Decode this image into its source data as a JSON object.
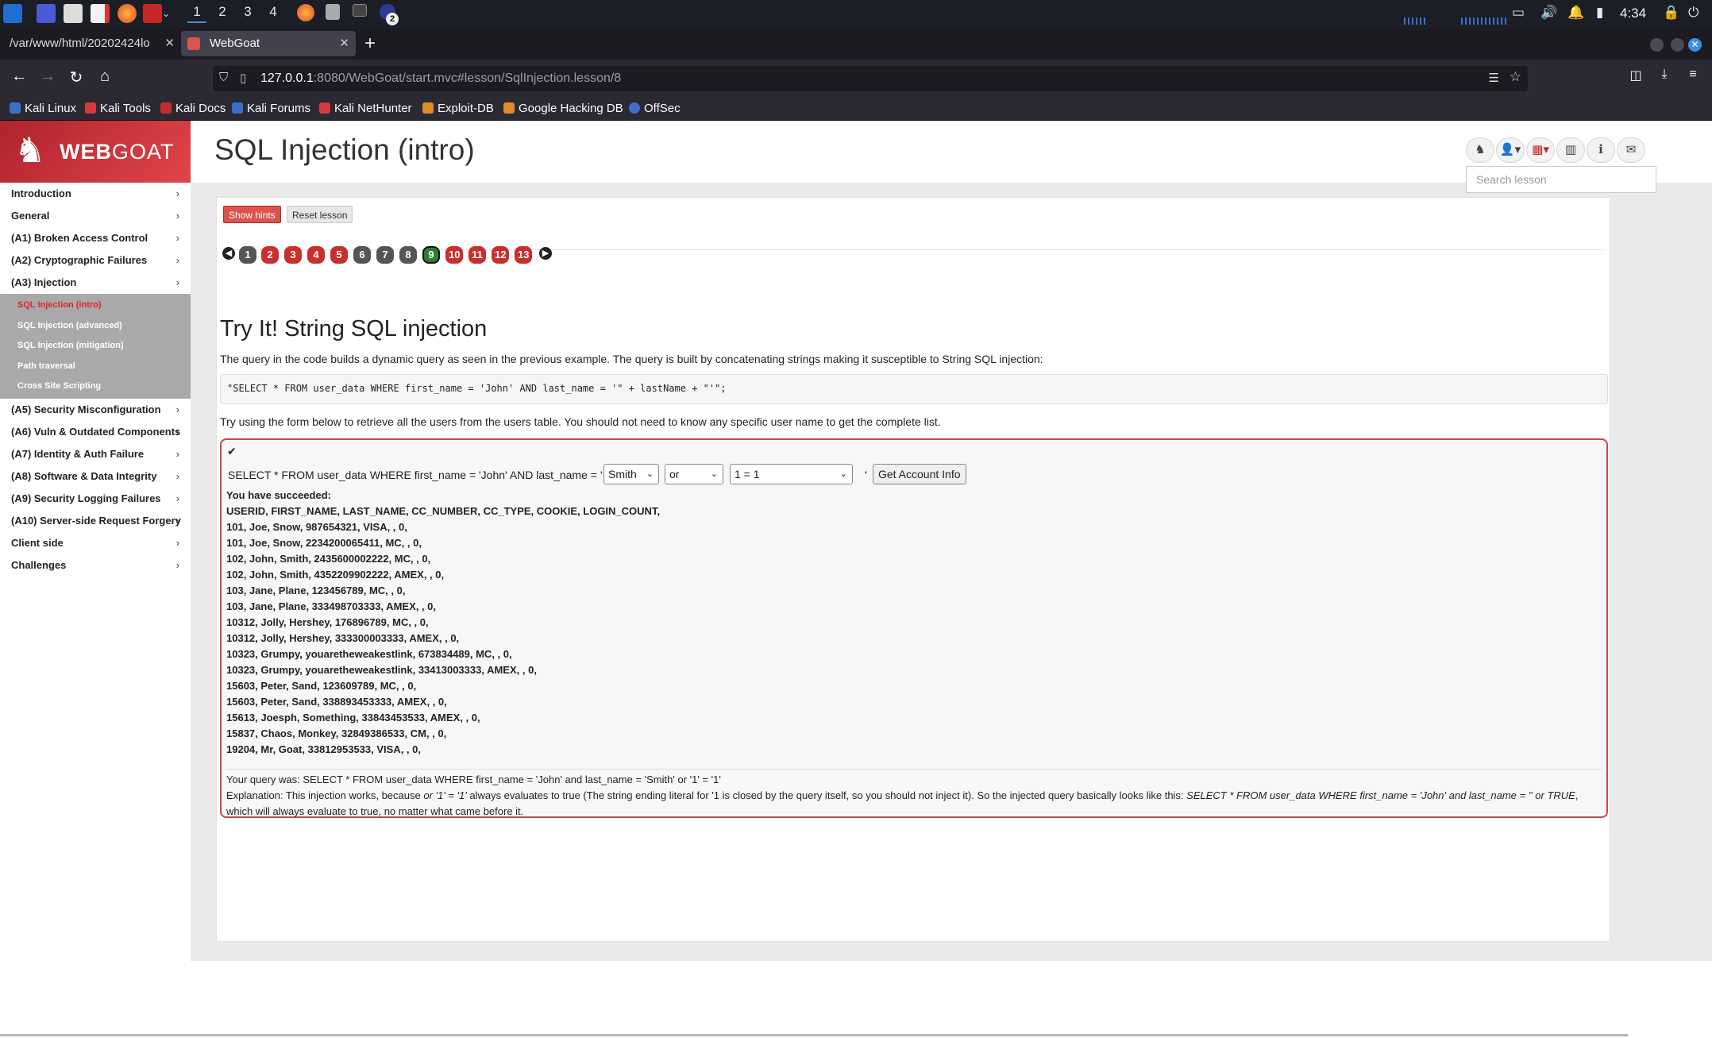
{
  "os_panel": {
    "workspaces": [
      "1",
      "2",
      "3",
      "4"
    ],
    "badge": "2",
    "clock": "4:34"
  },
  "browser": {
    "tabs": [
      {
        "label": "/var/www/html/20202424lo"
      },
      {
        "label": "WebGoat"
      }
    ],
    "url_host": "127.0.0.1",
    "url_rest": ":8080/WebGoat/start.mvc#lesson/SqlInjection.lesson/8",
    "bookmarks": [
      "Kali Linux",
      "Kali Tools",
      "Kali Docs",
      "Kali Forums",
      "Kali NetHunter",
      "Exploit-DB",
      "Google Hacking DB",
      "OffSec"
    ]
  },
  "logo": {
    "bold": "WEB",
    "regular": "GOAT"
  },
  "sidebar": {
    "categories_top": [
      "Introduction",
      "General",
      "(A1) Broken Access Control",
      "(A2) Cryptographic Failures",
      "(A3) Injection"
    ],
    "subitems": [
      "SQL Injection (intro)",
      "SQL Injection (advanced)",
      "SQL Injection (mitigation)",
      "Path traversal",
      "Cross Site Scripting"
    ],
    "categories_bottom": [
      "(A5) Security Misconfiguration",
      "(A6) Vuln & Outdated Components",
      "(A7) Identity & Auth Failure",
      "(A8) Software & Data Integrity",
      "(A9) Security Logging Failures",
      "(A10) Server-side Request Forgery",
      "Client side",
      "Challenges"
    ]
  },
  "header": {
    "title": "SQL Injection (intro)",
    "search_placeholder": "Search lesson"
  },
  "lesson": {
    "show_hints": "Show hints",
    "reset_lesson": "Reset lesson",
    "pages": [
      "1",
      "2",
      "3",
      "4",
      "5",
      "6",
      "7",
      "8",
      "9",
      "10",
      "11",
      "12",
      "13"
    ],
    "page_states": [
      "done",
      "todo",
      "todo",
      "todo",
      "todo",
      "done",
      "done",
      "done",
      "current",
      "todo",
      "todo",
      "todo",
      "todo"
    ],
    "section_title": "Try It! String SQL injection",
    "intro_text": "The query in the code builds a dynamic query as seen in the previous example. The query is built by concatenating strings making it susceptible to String SQL injection:",
    "code": "\"SELECT * FROM user_data WHERE first_name = 'John' AND last_name = '\" + lastName + \"'\";",
    "try_text": "Try using the form below to retrieve all the users from the users table. You should not need to know any specific user name to get the complete list.",
    "form": {
      "prefix": "SELECT * FROM user_data WHERE first_name = 'John' AND last_name = '",
      "select1": "Smith",
      "select2": "or",
      "select3": "1 = 1",
      "suffix": "'",
      "submit": "Get Account Info"
    },
    "result_title": "You have succeeded:",
    "result_header": "USERID, FIRST_NAME, LAST_NAME, CC_NUMBER, CC_TYPE, COOKIE, LOGIN_COUNT,",
    "result_rows": [
      "101, Joe, Snow, 987654321, VISA, , 0,",
      "101, Joe, Snow, 2234200065411, MC, , 0,",
      "102, John, Smith, 2435600002222, MC, , 0,",
      "102, John, Smith, 4352209902222, AMEX, , 0,",
      "103, Jane, Plane, 123456789, MC, , 0,",
      "103, Jane, Plane, 333498703333, AMEX, , 0,",
      "10312, Jolly, Hershey, 176896789, MC, , 0,",
      "10312, Jolly, Hershey, 333300003333, AMEX, , 0,",
      "10323, Grumpy, youaretheweakestlink, 673834489, MC, , 0,",
      "10323, Grumpy, youaretheweakestlink, 33413003333, AMEX, , 0,",
      "15603, Peter, Sand, 123609789, MC, , 0,",
      "15603, Peter, Sand, 338893453333, AMEX, , 0,",
      "15613, Joesph, Something, 33843453533, AMEX, , 0,",
      "15837, Chaos, Monkey, 32849386533, CM, , 0,",
      "19204, Mr, Goat, 33812953533, VISA, , 0,"
    ],
    "query_was": "Your query was: SELECT * FROM user_data WHERE first_name = 'John' and last_name = 'Smith' or '1' = '1'",
    "explanation": {
      "p1": "Explanation: This injection works, because ",
      "i1": "or '1' = '1'",
      "p2": " always evaluates to true (The string ending literal for '1 is closed by the query itself, so you should not inject it). So the injected query basically looks like this: ",
      "i2": "SELECT * FROM user_data WHERE first_name = 'John' and last_name = '' or TRUE",
      "p3": ", which will always evaluate to true, no matter what came before it."
    }
  },
  "colors": {
    "webgoat_red": "#d9534f",
    "page_done": "#555555",
    "page_todo": "#c9302c",
    "page_current": "#2e7d32",
    "sidebar_sub_bg": "#a9a9a9",
    "active_sub": "#e0242a"
  }
}
